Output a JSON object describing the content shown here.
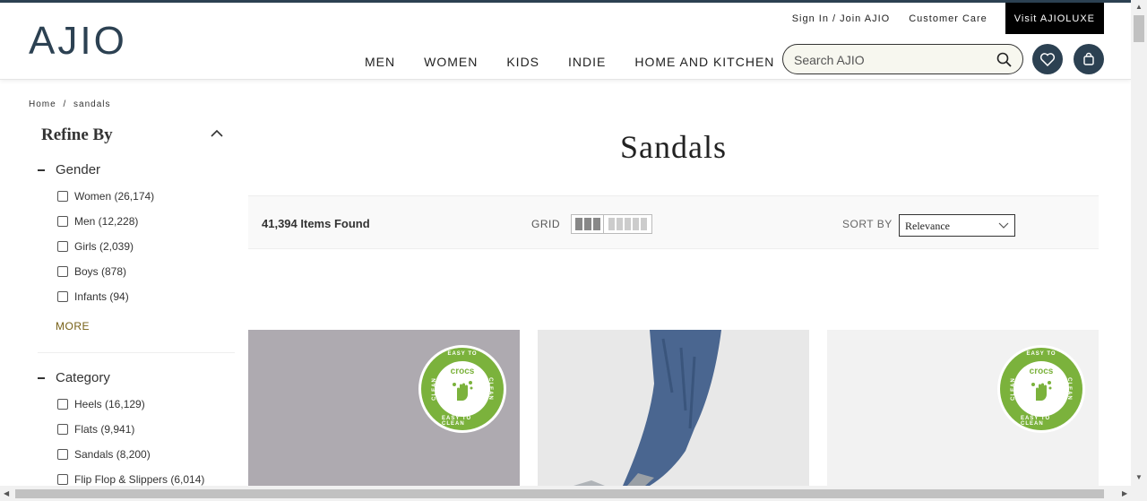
{
  "header": {
    "logo": "AJIO",
    "toplinks": {
      "signin": "Sign In / Join AJIO",
      "care": "Customer Care",
      "luxe": "Visit AJIOLUXE"
    },
    "nav": [
      "MEN",
      "WOMEN",
      "KIDS",
      "INDIE",
      "HOME AND KITCHEN"
    ],
    "search": {
      "placeholder": "Search AJIO"
    }
  },
  "breadcrumb": {
    "home": "Home",
    "sep": "/",
    "current": "sandals"
  },
  "sidebar": {
    "refine": "Refine By",
    "gender": {
      "title": "Gender",
      "options": [
        "Women (26,174)",
        "Men (12,228)",
        "Girls (2,039)",
        "Boys (878)",
        "Infants (94)"
      ],
      "more": "MORE"
    },
    "category": {
      "title": "Category",
      "options": [
        "Heels (16,129)",
        "Flats (9,941)",
        "Sandals (8,200)",
        "Flip Flop & Slippers (6,014)"
      ]
    }
  },
  "main": {
    "title": "Sandals",
    "items_found": "41,394 Items Found",
    "grid_label": "GRID",
    "sort_label": "SORT BY",
    "sort_value": "Relevance"
  },
  "products": [
    {
      "badge_brand": "crocs",
      "badge_top": "EASY TO",
      "badge_bottom": "EASY TO CLEAN",
      "badge_side": "CLEAN"
    },
    {},
    {
      "badge_brand": "crocs",
      "badge_top": "EASY TO",
      "badge_bottom": "EASY TO CLEAN",
      "badge_side": "CLEAN"
    }
  ],
  "colors": {
    "brand": "#2c4152",
    "badge_green": "#7bb23c",
    "more_link": "#776118"
  }
}
